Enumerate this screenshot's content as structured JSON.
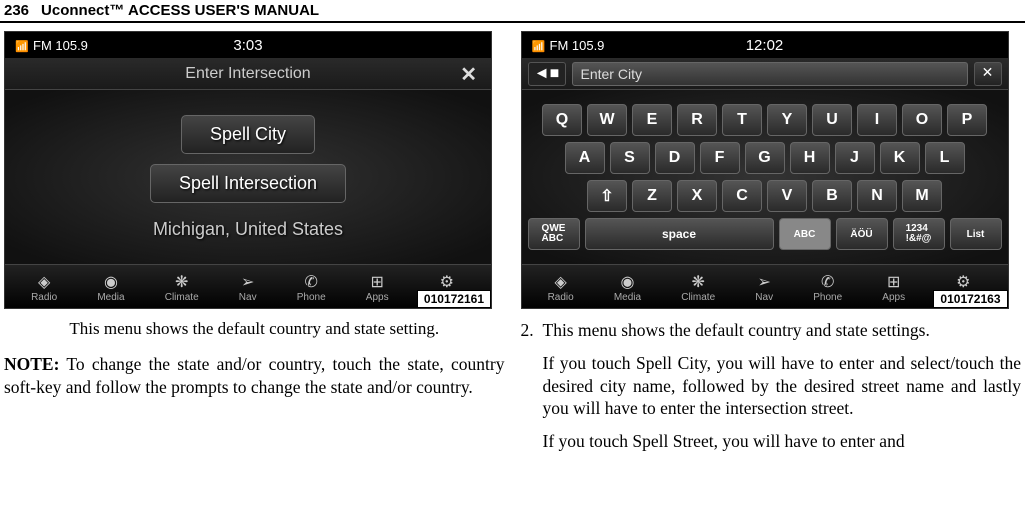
{
  "header": {
    "page_number": "236",
    "manual_title": "Uconnect™ ACCESS USER'S MANUAL"
  },
  "screenshot1": {
    "station": "FM 105.9",
    "time": "3:03",
    "title": "Enter Intersection",
    "buttons": [
      "Spell City",
      "Spell Intersection"
    ],
    "location": "Michigan, United States",
    "image_id": "010172161"
  },
  "screenshot2": {
    "station": "FM 105.9",
    "time": "12:02",
    "placeholder": "Enter City",
    "keyboard_rows": [
      [
        "Q",
        "W",
        "E",
        "R",
        "T",
        "Y",
        "U",
        "I",
        "O",
        "P"
      ],
      [
        "A",
        "S",
        "D",
        "F",
        "G",
        "H",
        "J",
        "K",
        "L"
      ],
      [
        "⇧",
        "Z",
        "X",
        "C",
        "V",
        "B",
        "N",
        "M"
      ]
    ],
    "bottom_row": {
      "qwe": "QWE\nABC",
      "space": "space",
      "abc": "ABC",
      "aou": "ÄÖÜ",
      "nums": "1234\n!&#@",
      "list": "List"
    },
    "image_id": "010172163"
  },
  "bottom_icons": [
    {
      "glyph": "◈",
      "label": "Radio"
    },
    {
      "glyph": "◉",
      "label": "Media"
    },
    {
      "glyph": "❋",
      "label": "Climate"
    },
    {
      "glyph": "➢",
      "label": "Nav"
    },
    {
      "glyph": "✆",
      "label": "Phone"
    },
    {
      "glyph": "⊞",
      "label": "Apps"
    },
    {
      "glyph": "⚙",
      "label": "Settings"
    }
  ],
  "left_col": {
    "caption": "This menu shows the default country and state setting.",
    "note_label": "NOTE:",
    "note_text": " To change the state and/or country, touch the state, country soft-key and follow the prompts to change the state and/or country."
  },
  "right_col": {
    "num": "2.",
    "para1": "This menu shows the default country and state settings.",
    "para2": "If you touch Spell City, you will have to enter and select/touch the desired city name, followed by the desired street name and lastly you will have to enter the intersection street.",
    "para3": "If you touch Spell Street, you will have to enter and"
  }
}
